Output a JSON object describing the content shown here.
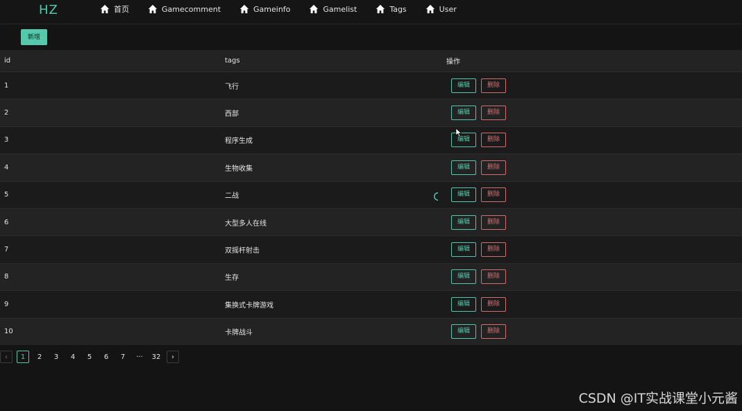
{
  "header": {
    "logo": "HZ",
    "nav": [
      {
        "label": "首页",
        "icon": "home-icon"
      },
      {
        "label": "Gamecomment",
        "icon": "home-icon"
      },
      {
        "label": "Gameinfo",
        "icon": "home-icon"
      },
      {
        "label": "Gamelist",
        "icon": "home-icon"
      },
      {
        "label": "Tags",
        "icon": "home-icon"
      },
      {
        "label": "User",
        "icon": "home-icon"
      }
    ]
  },
  "toolbar": {
    "add_label": "新增"
  },
  "table": {
    "columns": [
      "id",
      "tags",
      "操作"
    ],
    "edit_label": "编辑",
    "delete_label": "删除",
    "rows": [
      {
        "id": "1",
        "tag": "飞行"
      },
      {
        "id": "2",
        "tag": "西部"
      },
      {
        "id": "3",
        "tag": "程序生成"
      },
      {
        "id": "4",
        "tag": "生物收集"
      },
      {
        "id": "5",
        "tag": "二战"
      },
      {
        "id": "6",
        "tag": "大型多人在线"
      },
      {
        "id": "7",
        "tag": "双摇杆射击"
      },
      {
        "id": "8",
        "tag": "生存"
      },
      {
        "id": "9",
        "tag": "集换式卡牌游戏"
      },
      {
        "id": "10",
        "tag": "卡牌战斗"
      }
    ]
  },
  "pagination": {
    "prev": "‹",
    "next": "›",
    "current": "1",
    "pages": [
      "1",
      "2",
      "3",
      "4",
      "5",
      "6",
      "7",
      "···",
      "32"
    ]
  },
  "watermark": "CSDN @IT实战课堂小元酱",
  "colors": {
    "accent": "#56c9ac",
    "danger": "#d56e6e",
    "background": "#141414"
  }
}
